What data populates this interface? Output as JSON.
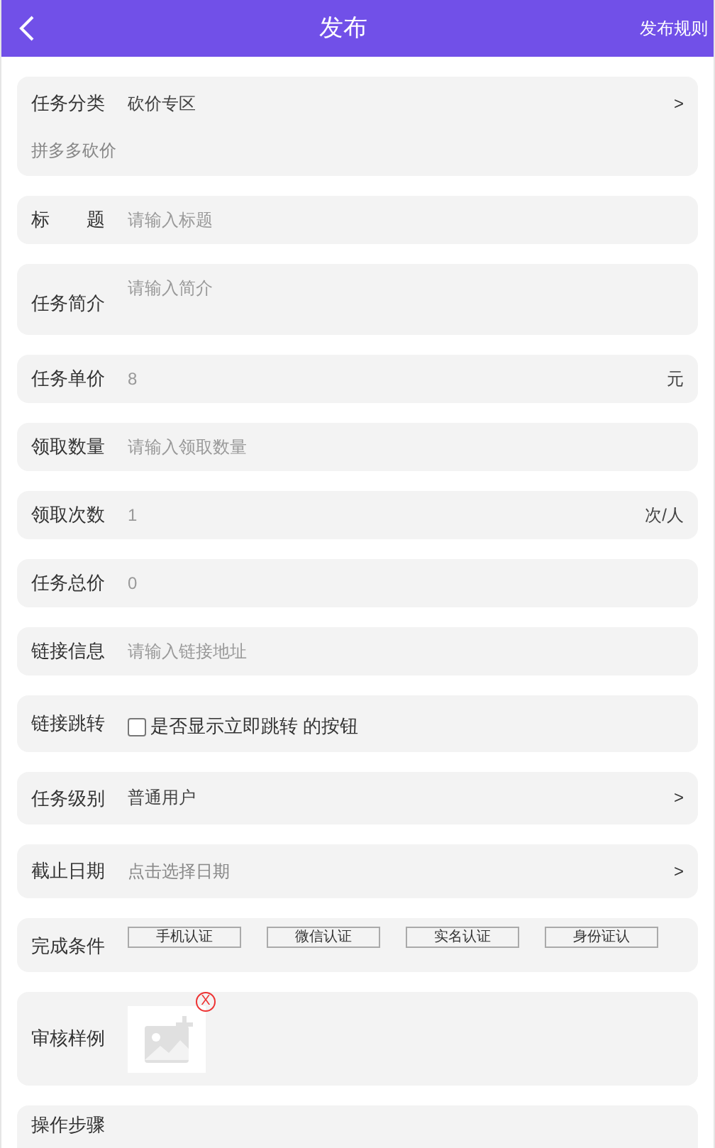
{
  "header": {
    "title": "发布",
    "action": "发布规则"
  },
  "fields": [
    {
      "kind": "select",
      "label": "任务分类",
      "value": "砍价专区",
      "arrow": ">",
      "note": "拼多多砍价"
    },
    {
      "kind": "input",
      "label": "标　　题",
      "placeholder": "请输入标题"
    },
    {
      "kind": "textarea",
      "label": "任务简介",
      "placeholder": "请输入简介"
    },
    {
      "kind": "input",
      "label": "任务单价",
      "placeholder": "8",
      "unit": "元"
    },
    {
      "kind": "input",
      "label": "领取数量",
      "placeholder": "请输入领取数量"
    },
    {
      "kind": "input",
      "label": "领取次数",
      "placeholder": "1",
      "unit": "次/人"
    },
    {
      "kind": "input",
      "label": "任务总价",
      "placeholder": "0"
    },
    {
      "kind": "input",
      "label": "链接信息",
      "placeholder": "请输入链接地址"
    },
    {
      "kind": "checkbox",
      "label": "链接跳转",
      "text": "是否显示立即跳转 的按钮",
      "checked": false
    },
    {
      "kind": "select",
      "label": "任务级别",
      "value": "普通用户",
      "arrow": ">"
    },
    {
      "kind": "select",
      "label": "截止日期",
      "placeholder": "点击选择日期",
      "arrow": ">"
    },
    {
      "kind": "tags",
      "label": "完成条件",
      "tags": [
        "手机认证",
        "微信认证",
        "实名认证",
        "身份证认"
      ]
    },
    {
      "kind": "image",
      "label": "审核样例",
      "remove": "X"
    },
    {
      "kind": "cut",
      "label": "操作步骤"
    }
  ]
}
